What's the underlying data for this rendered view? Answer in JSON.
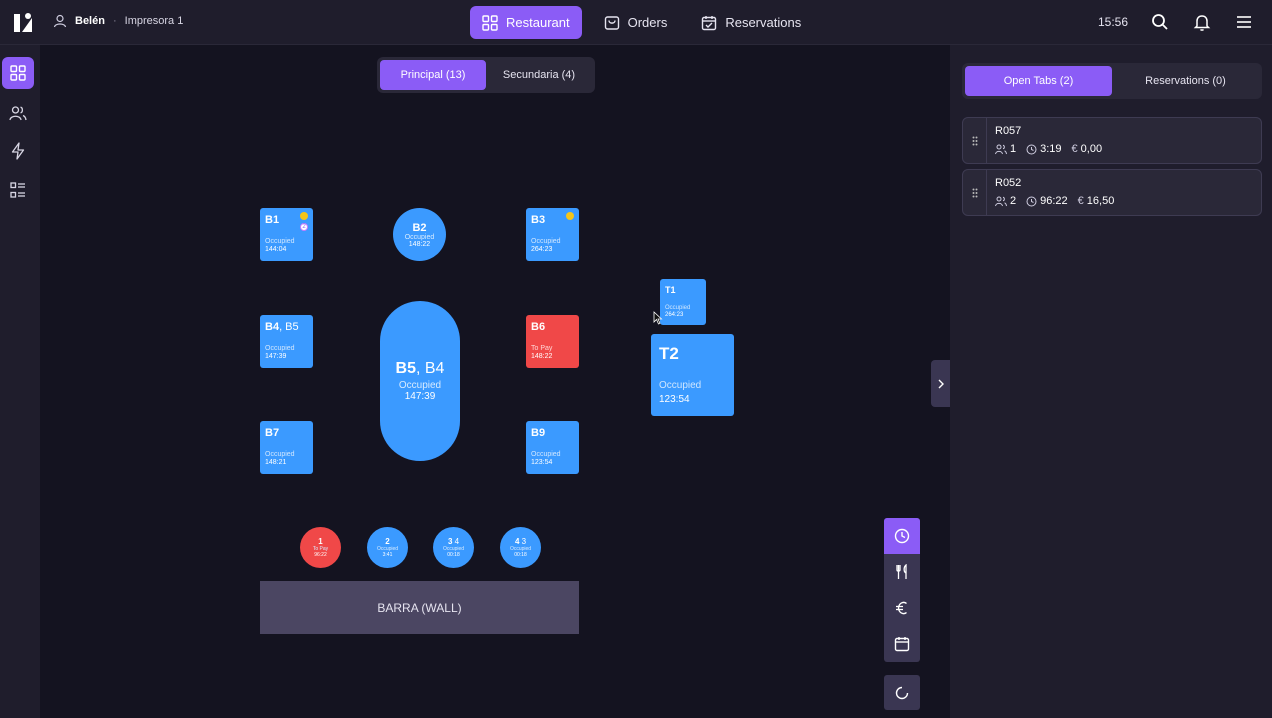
{
  "header": {
    "user_name": "Belén",
    "separator": "·",
    "printer": "Impresora 1",
    "nav": [
      {
        "label": "Restaurant",
        "icon": "grid-icon",
        "active": true
      },
      {
        "label": "Orders",
        "icon": "bag-icon",
        "active": false
      },
      {
        "label": "Reservations",
        "icon": "calendar-check-icon",
        "active": false
      }
    ],
    "time": "15:56"
  },
  "zones": [
    {
      "label": "Principal (13)",
      "active": true
    },
    {
      "label": "Secundaria (4)",
      "active": false
    }
  ],
  "tables": {
    "B1": {
      "name": "B1",
      "status": "Occupied",
      "time": "144:04",
      "badge": "2"
    },
    "B2": {
      "name": "B2",
      "status": "Occupied",
      "time": "148:22"
    },
    "B3": {
      "name": "B3",
      "status": "Occupied",
      "time": "264:23"
    },
    "B4": {
      "name": "B4",
      "sub": ", B5",
      "status": "Occupied",
      "time": "147:39"
    },
    "B5": {
      "name": "B5",
      "sub": ", B4",
      "status": "Occupied",
      "time": "147:39"
    },
    "B6": {
      "name": "B6",
      "status": "To Pay",
      "time": "148:22"
    },
    "B7": {
      "name": "B7",
      "status": "Occupied",
      "time": "148:21"
    },
    "B9": {
      "name": "B9",
      "status": "Occupied",
      "time": "123:54"
    },
    "T1": {
      "name": "T1",
      "status": "Occupied",
      "time": "264:23"
    },
    "T2": {
      "name": "T2",
      "status": "Occupied",
      "time": "123:54"
    },
    "R1": {
      "name": "1",
      "status": "To Pay",
      "time": "96:22"
    },
    "R2": {
      "name": "2",
      "status": "Occupied",
      "time": "3:41"
    },
    "R3": {
      "name": "3",
      "sub": " 4",
      "status": "Occupied",
      "time": "00:18"
    },
    "R4": {
      "name": "4",
      "sub": " 3",
      "status": "Occupied",
      "time": "00:18"
    }
  },
  "wall_label": "BARRA (WALL)",
  "right_panel": {
    "tabs": [
      {
        "label": "Open Tabs (2)",
        "active": true
      },
      {
        "label": "Reservations (0)",
        "active": false
      }
    ],
    "open_tabs": [
      {
        "code": "R057",
        "guests": "1",
        "duration": "3:19",
        "currency": "€",
        "amount": "0,00"
      },
      {
        "code": "R052",
        "guests": "2",
        "duration": "96:22",
        "currency": "€",
        "amount": "16,50"
      }
    ]
  },
  "colors": {
    "accent": "#8b5cf6",
    "occupied": "#3b9aff",
    "to_pay": "#f04848",
    "background": "#141320"
  }
}
